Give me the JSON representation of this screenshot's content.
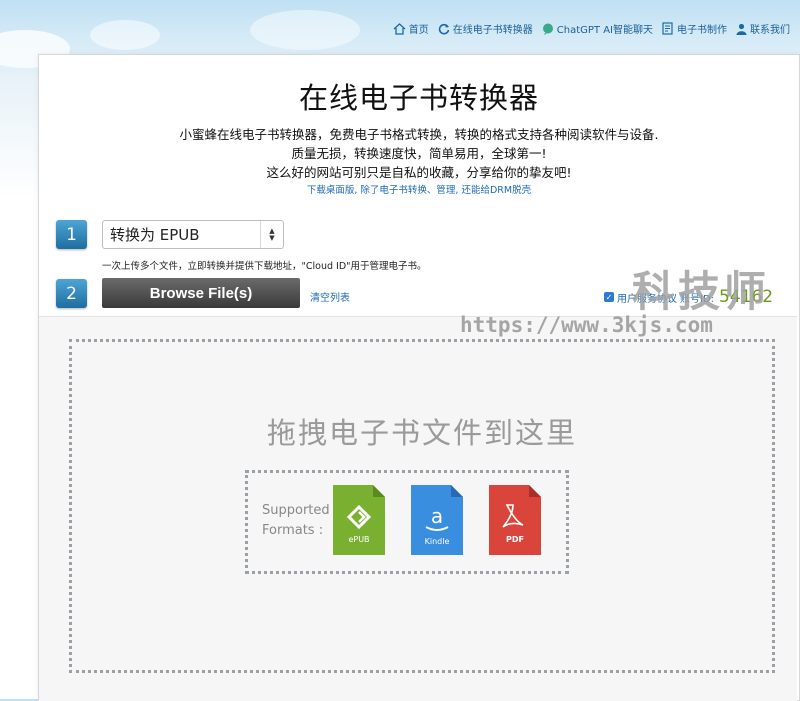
{
  "nav": {
    "items": [
      {
        "label": "首页",
        "icon": "home-icon"
      },
      {
        "label": "在线电子书转换器",
        "icon": "refresh-icon"
      },
      {
        "label": "ChatGPT AI智能聊天",
        "icon": "chat-icon"
      },
      {
        "label": "电子书制作",
        "icon": "ebook-icon"
      },
      {
        "label": "联系我们",
        "icon": "user-icon"
      }
    ]
  },
  "header": {
    "title": "在线电子书转换器",
    "desc_line1": "小蜜蜂在线电子书转换器，免费电子书格式转换，转换的格式支持各种阅读软件与设备.",
    "desc_line2": "质量无损，转换速度快，简单易用，全球第一!",
    "desc_line3": "这么好的网站可别只是自私的收藏，分享给你的挚友吧!",
    "download_link": "下载桌面版, 除了电子书转换、管理, 还能给DRM脱壳"
  },
  "step1": {
    "number": "1",
    "select_value": "转换为 EPUB",
    "hint": "一次上传多个文件，立即转换并提供下载地址，\"Cloud ID\"用于管理电子书。"
  },
  "step2": {
    "number": "2",
    "browse_label": "Browse File(s)",
    "clear_label": "清空列表",
    "agree_label": "用户服务协议",
    "uid_label": "账号ID:",
    "uid_value": "54162"
  },
  "dropzone": {
    "title": "拖拽电子书文件到这里",
    "supported_line1": "Supported",
    "supported_line2": "Formats :",
    "formats": [
      {
        "name": "ePUB",
        "color": "#7ab030"
      },
      {
        "name": "Kindle",
        "color": "#3a8ee0"
      },
      {
        "name": "PDF",
        "color": "#d9453a"
      }
    ]
  },
  "watermark": {
    "text": "科技师",
    "url": "https://www.3kjs.com"
  }
}
